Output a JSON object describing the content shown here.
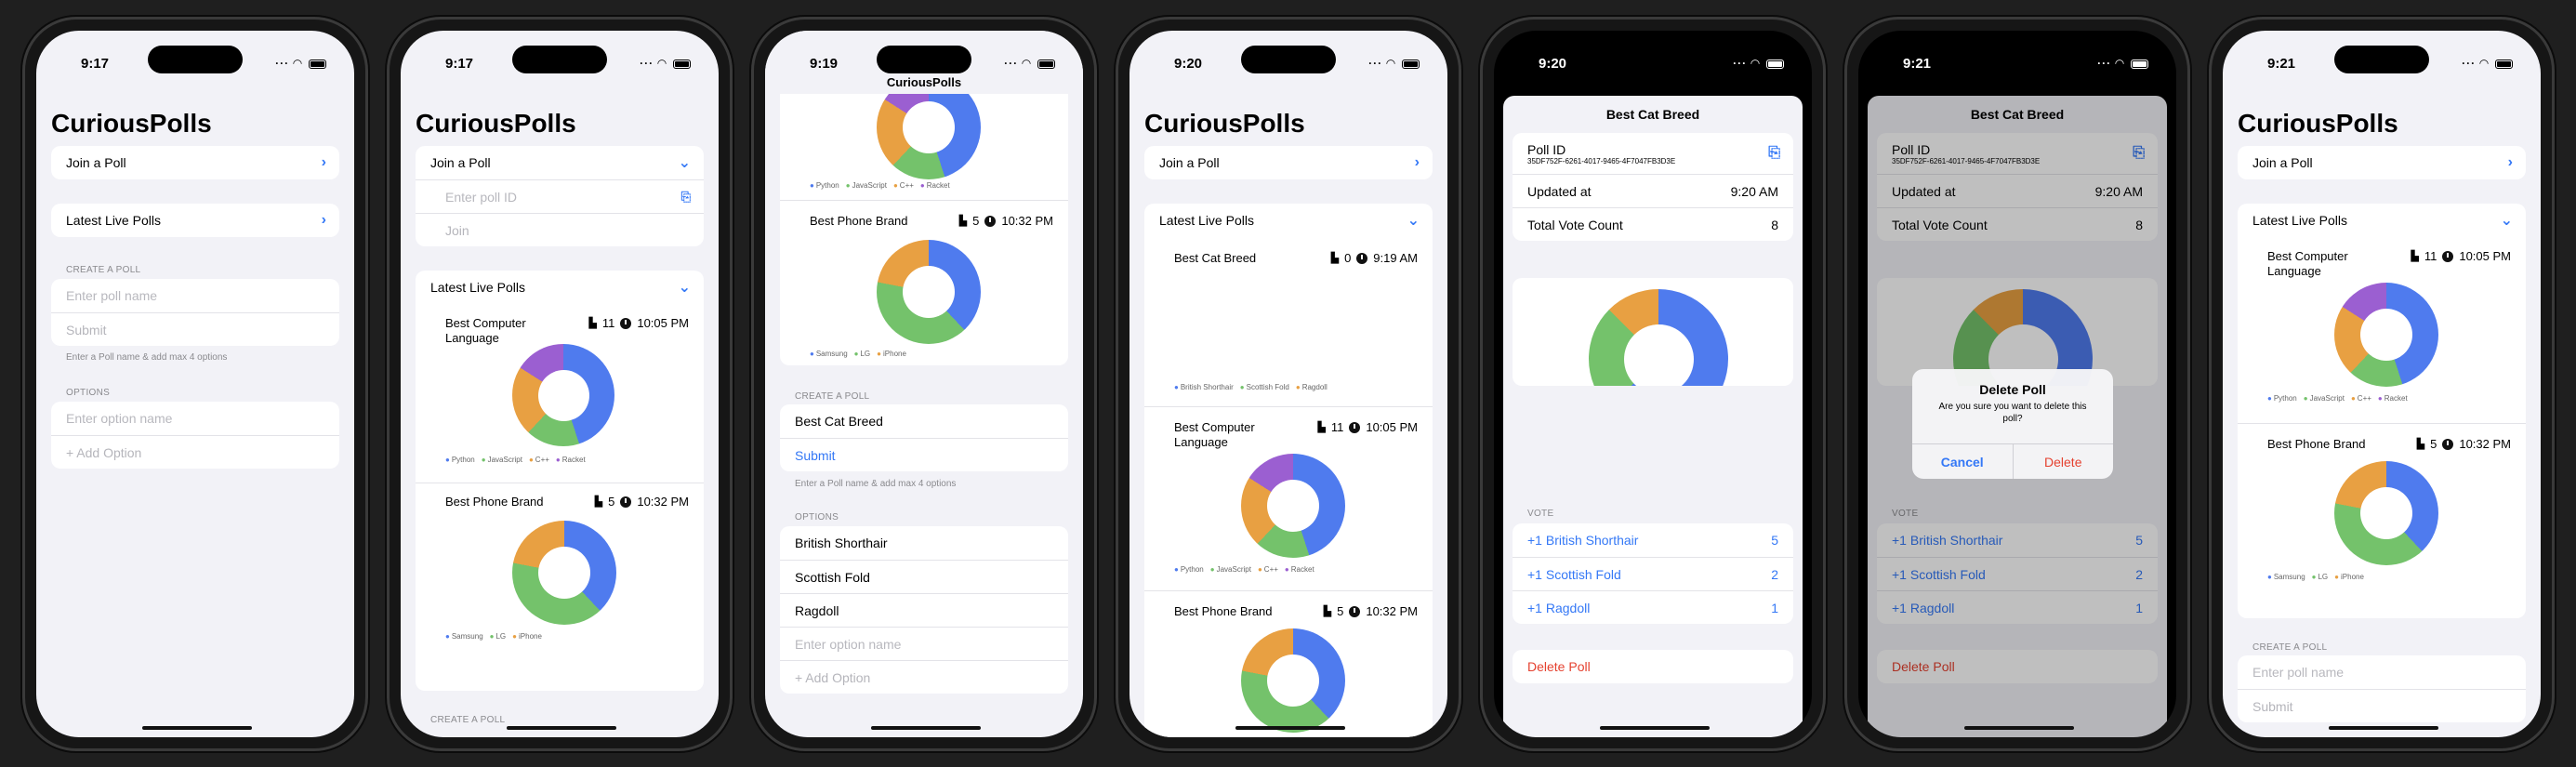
{
  "app_title": "CuriousPolls",
  "times": [
    "9:17",
    "9:17",
    "9:19",
    "9:20",
    "9:20",
    "9:21",
    "9:21"
  ],
  "status_icons": "···",
  "nav": {
    "join_poll": "Join a Poll",
    "latest_live_polls": "Latest Live Polls"
  },
  "join": {
    "placeholder": "Enter poll ID",
    "join_button": "Join"
  },
  "create": {
    "section": "CREATE A POLL",
    "name_placeholder": "Enter poll name",
    "name_value": "Best Cat Breed",
    "submit": "Submit",
    "footnote": "Enter a Poll name & add max 4 options",
    "options_section": "OPTIONS",
    "option_placeholder": "Enter option name",
    "add_option": "+ Add Option",
    "options": [
      "British Shorthair",
      "Scottish Fold",
      "Ragdoll"
    ]
  },
  "polls": {
    "cat": {
      "title": "Best Cat Breed",
      "count": "0",
      "time": "9:19 AM",
      "legend": [
        "British Shorthair",
        "Scottish Fold",
        "Ragdoll"
      ]
    },
    "lang": {
      "title": "Best Computer Language",
      "count": "11",
      "time": "10:05 PM",
      "legend": [
        "Python",
        "JavaScript",
        "C++",
        "Racket"
      ]
    },
    "phone": {
      "title": "Best Phone Brand",
      "count": "5",
      "time": "10:32 PM",
      "legend": [
        "Samsung",
        "LG",
        "iPhone"
      ]
    }
  },
  "detail": {
    "title": "Best Cat Breed",
    "poll_id_label": "Poll ID",
    "poll_id": "35DF752F-6261-4017-9465-4F7047FB3D3E",
    "updated_label": "Updated at",
    "updated_value": "9:20 AM",
    "total_label": "Total Vote Count",
    "total_value": "8",
    "vote_section": "VOTE",
    "votes": [
      {
        "label": "+1  British Shorthair",
        "count": "5"
      },
      {
        "label": "+1  Scottish Fold",
        "count": "2"
      },
      {
        "label": "+1  Ragdoll",
        "count": "1"
      }
    ],
    "delete": "Delete Poll"
  },
  "alert": {
    "title": "Delete Poll",
    "message": "Are you sure you want to delete this poll?",
    "cancel": "Cancel",
    "delete": "Delete"
  },
  "colors": {
    "blue": "#4f7bee",
    "green": "#74c26b",
    "orange": "#e8a042",
    "purple": "#9b5fd1",
    "accent": "#3478f6",
    "destructive": "#e5412f"
  }
}
